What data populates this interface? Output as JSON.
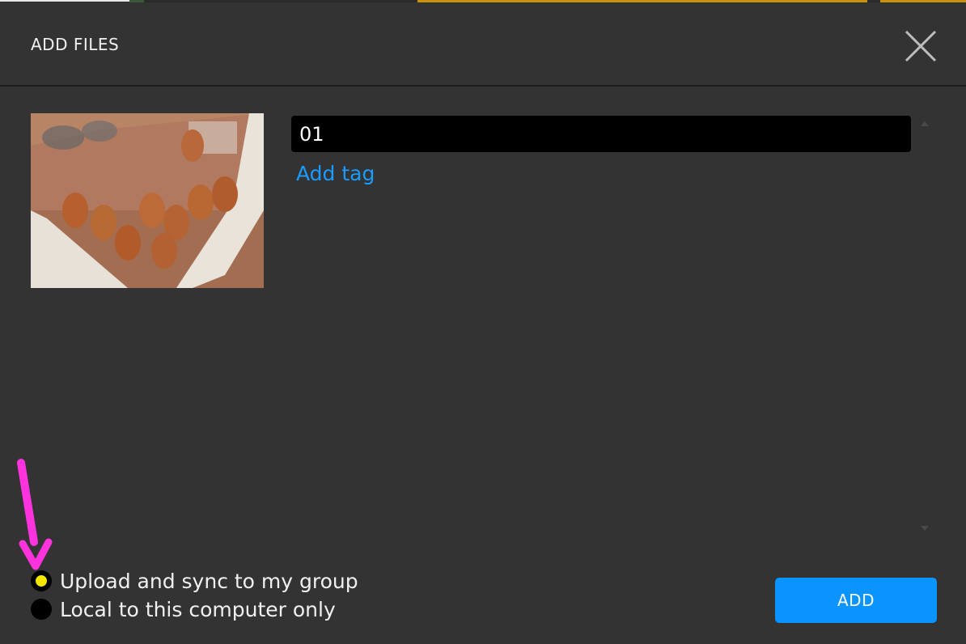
{
  "dialog": {
    "title": "ADD FILES",
    "close_icon": "close-icon"
  },
  "file": {
    "thumbnail_icon": "photo-thumbnail",
    "name_value": "01",
    "add_tag_label": "Add tag"
  },
  "storage_options": [
    {
      "label": "Upload and sync to my group",
      "selected": true
    },
    {
      "label": "Local to this computer only",
      "selected": false
    }
  ],
  "footer": {
    "add_label": "ADD"
  },
  "colors": {
    "background": "#333333",
    "accent": "#0a94ff",
    "link": "#1a9bff",
    "radio_selected": "#f2e600",
    "annotation_arrow": "#ff33dd"
  }
}
